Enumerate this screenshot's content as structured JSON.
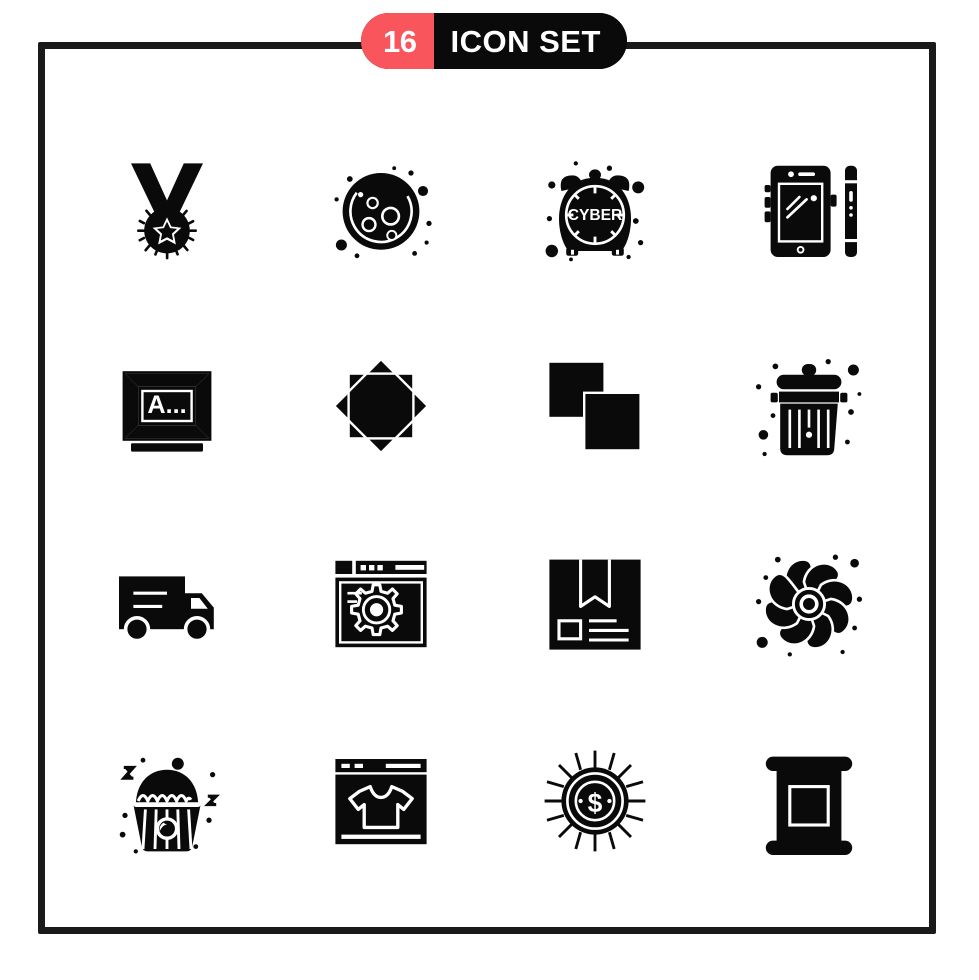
{
  "poster": {
    "background_color": "#ffffff",
    "frame_color": "#1a1a1a",
    "accent_color": "#f8565c",
    "icon_color": "#0a0a0a"
  },
  "header": {
    "count": "16",
    "title": "ICON SET"
  },
  "icons": [
    {
      "position": 1,
      "row": 1,
      "col": 1,
      "name": "medal-star-icon",
      "label": "Medal"
    },
    {
      "position": 2,
      "row": 1,
      "col": 2,
      "name": "moon-craters-icon",
      "label": "Moon"
    },
    {
      "position": 3,
      "row": 1,
      "col": 3,
      "name": "cyber-alarm-clock-icon",
      "label": "Cyber Monday Clock",
      "glyph_text": "CYBER"
    },
    {
      "position": 4,
      "row": 1,
      "col": 4,
      "name": "smartphone-icon",
      "label": "Smartphone"
    },
    {
      "position": 5,
      "row": 2,
      "col": 1,
      "name": "monitor-text-icon",
      "label": "Monitor",
      "glyph_text": "A..."
    },
    {
      "position": 6,
      "row": 2,
      "col": 2,
      "name": "eight-point-star-icon",
      "label": "Eight Pointed Star"
    },
    {
      "position": 7,
      "row": 2,
      "col": 3,
      "name": "copy-squares-icon",
      "label": "Copy"
    },
    {
      "position": 8,
      "row": 2,
      "col": 4,
      "name": "trash-bin-icon",
      "label": "Trash"
    },
    {
      "position": 9,
      "row": 3,
      "col": 1,
      "name": "delivery-truck-icon",
      "label": "Delivery Truck"
    },
    {
      "position": 10,
      "row": 3,
      "col": 2,
      "name": "browser-settings-icon",
      "label": "Web Settings"
    },
    {
      "position": 11,
      "row": 3,
      "col": 3,
      "name": "package-box-icon",
      "label": "Package"
    },
    {
      "position": 12,
      "row": 3,
      "col": 4,
      "name": "flower-pinwheel-icon",
      "label": "Flower"
    },
    {
      "position": 13,
      "row": 4,
      "col": 1,
      "name": "cupcake-icon",
      "label": "Cupcake"
    },
    {
      "position": 14,
      "row": 4,
      "col": 2,
      "name": "browser-tshirt-icon",
      "label": "Online Shopping"
    },
    {
      "position": 15,
      "row": 4,
      "col": 3,
      "name": "dollar-coin-rays-icon",
      "label": "Money"
    },
    {
      "position": 16,
      "row": 4,
      "col": 4,
      "name": "roll-up-banner-icon",
      "label": "Banner Stand"
    }
  ]
}
